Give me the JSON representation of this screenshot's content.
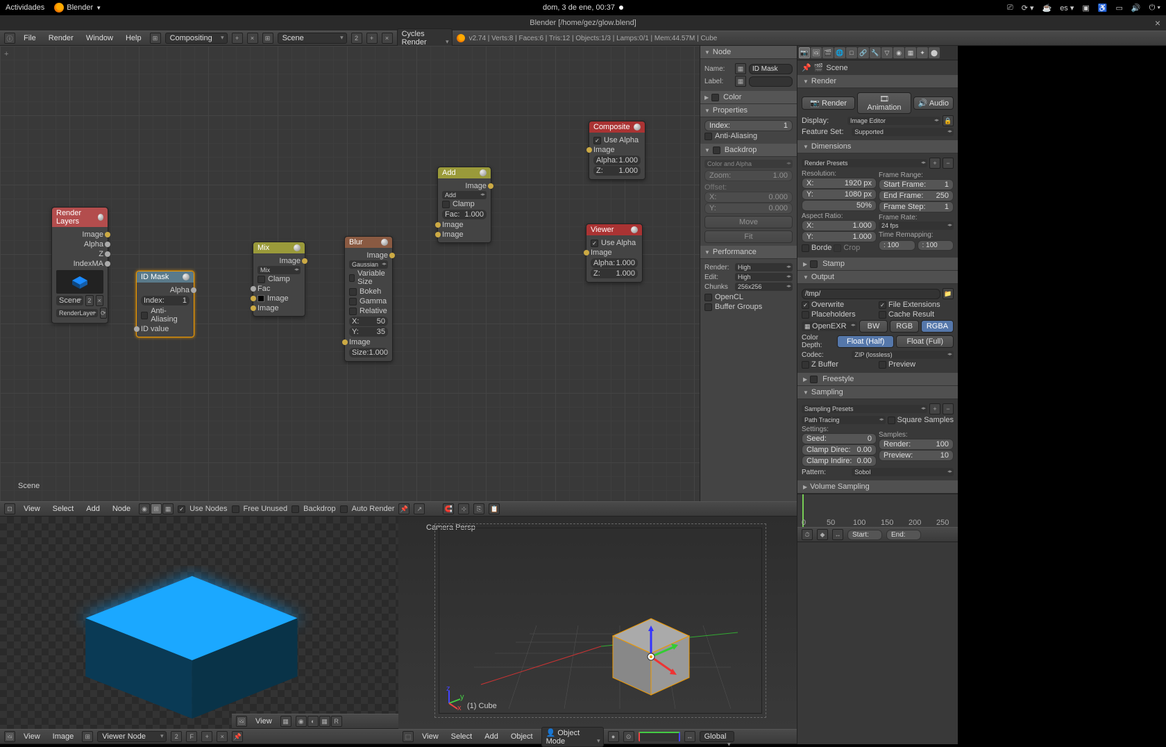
{
  "desktop": {
    "activities": "Actividades",
    "app_name": "Blender",
    "datetime": "dom,  3 de ene, 00:37",
    "lang": "es"
  },
  "window": {
    "title": "Blender  [/home/gez/glow.blend]"
  },
  "info_header": {
    "menus": [
      "File",
      "Render",
      "Window",
      "Help"
    ],
    "layout": "Compositing",
    "scene": "Scene",
    "scene_users": "2",
    "engine": "Cycles Render",
    "stats": "v2.74 | Verts:8 | Faces:6 | Tris:12 | Objects:1/3 | Lamps:0/1 | Mem:44.57M | Cube"
  },
  "node_editor": {
    "scene_label": "Scene",
    "header": {
      "menus": [
        "View",
        "Select",
        "Add",
        "Node"
      ],
      "use_nodes_label": "Use Nodes",
      "free_unused_label": "Free Unused",
      "backdrop_label": "Backdrop",
      "auto_render_label": "Auto Render"
    },
    "sidebar": {
      "node_section": "Node",
      "name_label": "Name:",
      "name_value": "ID Mask",
      "label_label": "Label:",
      "color_section": "Color",
      "properties_section": "Properties",
      "index_label": "Index:",
      "index_value": "1",
      "anti_aliasing_label": "Anti-Aliasing",
      "backdrop_section": "Backdrop",
      "backdrop_mode": "Color and Alpha",
      "zoom_label": "Zoom:",
      "zoom_value": "1.00",
      "offset_label": "Offset:",
      "offset_x_label": "X:",
      "offset_x_value": "0.000",
      "offset_y_label": "Y:",
      "offset_y_value": "0.000",
      "move_btn": "Move",
      "fit_btn": "Fit",
      "performance_section": "Performance",
      "render_label": "Render:",
      "render_value": "High",
      "edit_label": "Edit:",
      "edit_value": "High",
      "chunks_label": "Chunks",
      "chunks_value": "256x256",
      "opencl_label": "OpenCL",
      "buffer_groups_label": "Buffer Groups"
    },
    "nodes": {
      "render_layers": {
        "title": "Render Layers",
        "outputs": [
          "Image",
          "Alpha",
          "Z",
          "IndexMA"
        ],
        "scene": "Scene",
        "scene_users": "2",
        "layer": "RenderLayer"
      },
      "id_mask": {
        "title": "ID Mask",
        "output": "Alpha",
        "index_label": "Index:",
        "index_value": "1",
        "anti_aliasing": "Anti-Aliasing",
        "input": "ID value"
      },
      "mix": {
        "title": "Mix",
        "output": "Image",
        "mode": "Mix",
        "clamp": "Clamp",
        "fac": "Fac",
        "image1": "Image",
        "image2": "Image"
      },
      "blur": {
        "title": "Blur",
        "output": "Image",
        "mode": "Gaussian",
        "variable_size": "Variable Size",
        "bokeh": "Bokeh",
        "gamma": "Gamma",
        "relative": "Relative",
        "x_label": "X:",
        "x_value": "50",
        "y_label": "Y:",
        "y_value": "35",
        "input": "Image",
        "size_label": "Size:",
        "size_value": "1.000"
      },
      "add": {
        "title": "Add",
        "output": "Image",
        "mode": "Add",
        "clamp": "Clamp",
        "fac_label": "Fac:",
        "fac_value": "1.000",
        "image1": "Image",
        "image2": "Image"
      },
      "composite": {
        "title": "Composite",
        "use_alpha": "Use Alpha",
        "image": "Image",
        "alpha_label": "Alpha:",
        "alpha_value": "1.000",
        "z_label": "Z:",
        "z_value": "1.000"
      },
      "viewer": {
        "title": "Viewer",
        "use_alpha": "Use Alpha",
        "image": "Image",
        "alpha_label": "Alpha:",
        "alpha_value": "1.000",
        "z_label": "Z:",
        "z_value": "1.000"
      }
    }
  },
  "image_editor": {
    "header": {
      "menus": [
        "View",
        "Image"
      ],
      "image": "Viewer Node",
      "users": "2",
      "fake": "F"
    }
  },
  "viewport3d": {
    "camera_label": "Camera Persp",
    "object_label": "(1) Cube",
    "header": {
      "menus": [
        "View",
        "Select",
        "Add",
        "Object"
      ],
      "mode": "Object Mode",
      "global": "Global"
    }
  },
  "properties": {
    "context": "Scene",
    "render": {
      "section": "Render",
      "render_btn": "Render",
      "anim_btn": "Animation",
      "audio_btn": "Audio",
      "display_label": "Display:",
      "display_value": "Image Editor",
      "feature_label": "Feature Set:",
      "feature_value": "Supported"
    },
    "dimensions": {
      "section": "Dimensions",
      "presets": "Render Presets",
      "resolution_label": "Resolution:",
      "res_x_label": "X:",
      "res_x": "1920 px",
      "res_y_label": "Y:",
      "res_y": "1080 px",
      "percent": "50%",
      "aspect_label": "Aspect Ratio:",
      "aspect_x_label": "X:",
      "aspect_x": "1.000",
      "aspect_y_label": "Y:",
      "aspect_y": "1.000",
      "border_label": "Borde",
      "crop_label": "Crop",
      "frame_range_label": "Frame Range:",
      "start_label": "Start Frame:",
      "start": "1",
      "end_label": "End Frame:",
      "end": "250",
      "step_label": "Frame Step:",
      "step": "1",
      "rate_label": "Frame Rate:",
      "fps": "24 fps",
      "remapping_label": "Time Remapping:",
      "remap_old": ": 100",
      "remap_new": ": 100"
    },
    "stamp": "Stamp",
    "output": {
      "section": "Output",
      "path": "/tmp/",
      "overwrite": "Overwrite",
      "file_ext": "File Extensions",
      "placeholders": "Placeholders",
      "cache_result": "Cache Result",
      "format": "OpenEXR",
      "bw": "BW",
      "rgb": "RGB",
      "rgba": "RGBA",
      "color_depth_label": "Color Depth:",
      "float_half": "Float (Half)",
      "float_full": "Float (Full)",
      "codec_label": "Codec:",
      "codec": "ZIP (lossless)",
      "zbuffer": "Z Buffer",
      "preview": "Preview"
    },
    "freestyle": "Freestyle",
    "sampling": {
      "section": "Sampling",
      "presets": "Sampling Presets",
      "integrator": "Path Tracing",
      "square": "Square Samples",
      "settings_label": "Settings:",
      "samples_label": "Samples:",
      "seed_label": "Seed:",
      "seed": "0",
      "render_label": "Render:",
      "render": "100",
      "clamp_direct_label": "Clamp Direc:",
      "clamp_direct": "0.00",
      "preview_label": "Preview:",
      "preview_samples": "10",
      "clamp_indirect_label": "Clamp Indire:",
      "clamp_indirect": "0.00",
      "pattern_label": "Pattern:",
      "pattern": "Sobol"
    },
    "volume_sampling": "Volume Sampling"
  },
  "timeline": {
    "ticks": [
      "0",
      "50",
      "100",
      "150",
      "200",
      "250"
    ],
    "start_label": "Start:",
    "end_label": "End:"
  }
}
